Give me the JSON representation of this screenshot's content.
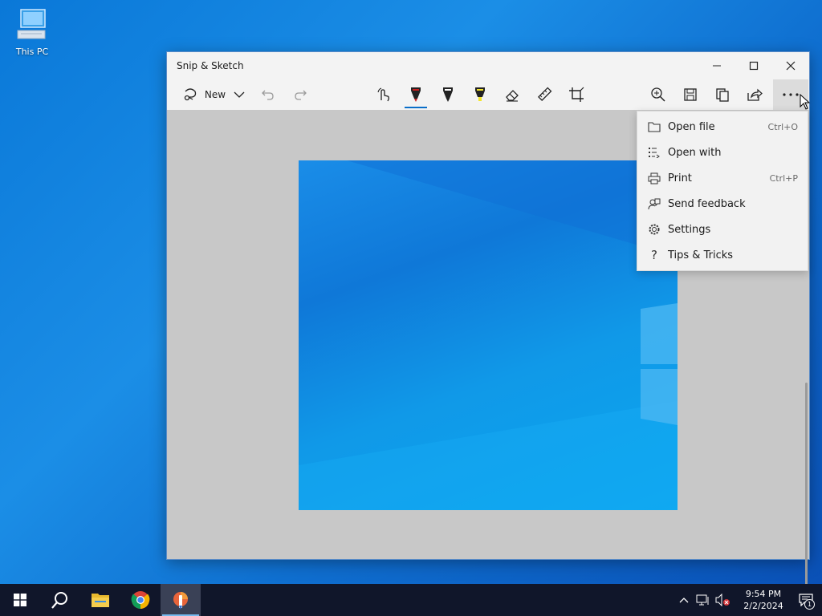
{
  "desktop": {
    "icons": [
      {
        "label": "This PC",
        "icon": "computer-icon"
      }
    ]
  },
  "window": {
    "title": "Snip & Sketch",
    "controls": {
      "minimize": "—",
      "maximize": "☐",
      "close": "✕"
    }
  },
  "toolbar": {
    "new_label": "New",
    "tools": [
      "snip-icon",
      "undo-icon",
      "redo-icon",
      "touch-writing-icon",
      "ballpoint-pen-icon",
      "pencil-icon",
      "highlighter-icon",
      "eraser-icon",
      "ruler-icon",
      "crop-icon",
      "zoom-icon",
      "save-icon",
      "copy-icon",
      "share-icon",
      "more-icon"
    ],
    "active_pen_color": "#c81e1e",
    "highlighter_color": "#f3e52b",
    "accent": "#0a6ec9"
  },
  "menu": {
    "items": [
      {
        "label": "Open file",
        "shortcut": "Ctrl+O",
        "icon": "folder-icon"
      },
      {
        "label": "Open with",
        "shortcut": "",
        "icon": "open-with-icon"
      },
      {
        "label": "Print",
        "shortcut": "Ctrl+P",
        "icon": "print-icon"
      },
      {
        "label": "Send feedback",
        "shortcut": "",
        "icon": "feedback-icon"
      },
      {
        "label": "Settings",
        "shortcut": "",
        "icon": "settings-icon"
      },
      {
        "label": "Tips & Tricks",
        "shortcut": "",
        "icon": "help-icon"
      }
    ]
  },
  "taskbar": {
    "apps": [
      "start-icon",
      "search-icon",
      "file-explorer-icon",
      "chrome-icon",
      "snip-sketch-icon"
    ],
    "clock": {
      "time": "9:54 PM",
      "date": "2/2/2024"
    },
    "notification_count": "1"
  }
}
